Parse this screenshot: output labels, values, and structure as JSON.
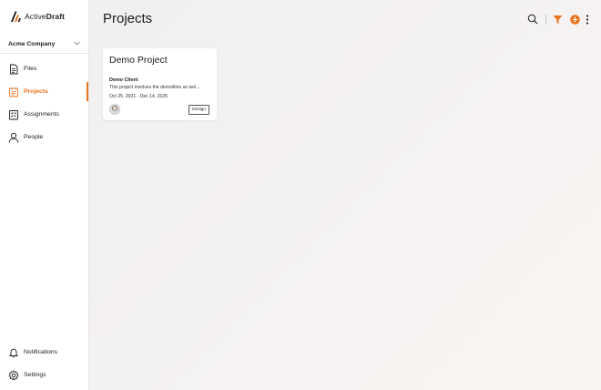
{
  "brand": {
    "name_prefix": "Active",
    "name_suffix": "Draft"
  },
  "company": {
    "name": "Acme Company"
  },
  "nav": {
    "items": [
      {
        "label": "Files",
        "icon": "file-icon",
        "active": false
      },
      {
        "label": "Projects",
        "icon": "projects-icon",
        "active": true
      },
      {
        "label": "Assignments",
        "icon": "assignments-icon",
        "active": false
      },
      {
        "label": "People",
        "icon": "person-icon",
        "active": false
      }
    ],
    "bottom": [
      {
        "label": "Notifications",
        "icon": "bell-icon"
      },
      {
        "label": "Settings",
        "icon": "gear-icon"
      }
    ]
  },
  "page": {
    "title": "Projects"
  },
  "toolbar": {
    "icons": [
      "search-icon",
      "filter-icon",
      "add-icon",
      "more-vertical-icon"
    ]
  },
  "projects": [
    {
      "title": "Demo Project",
      "client": "Demo Client",
      "description": "This project involves the demolition as wel...",
      "dates": "Oct 25, 2021 - Dec 14, 2025",
      "tag": "Design"
    }
  ],
  "colors": {
    "accent": "#e8741e",
    "text": "#1c1c1c",
    "sidebar_bg": "#ffffff",
    "main_bg": "#f3f1f2"
  }
}
